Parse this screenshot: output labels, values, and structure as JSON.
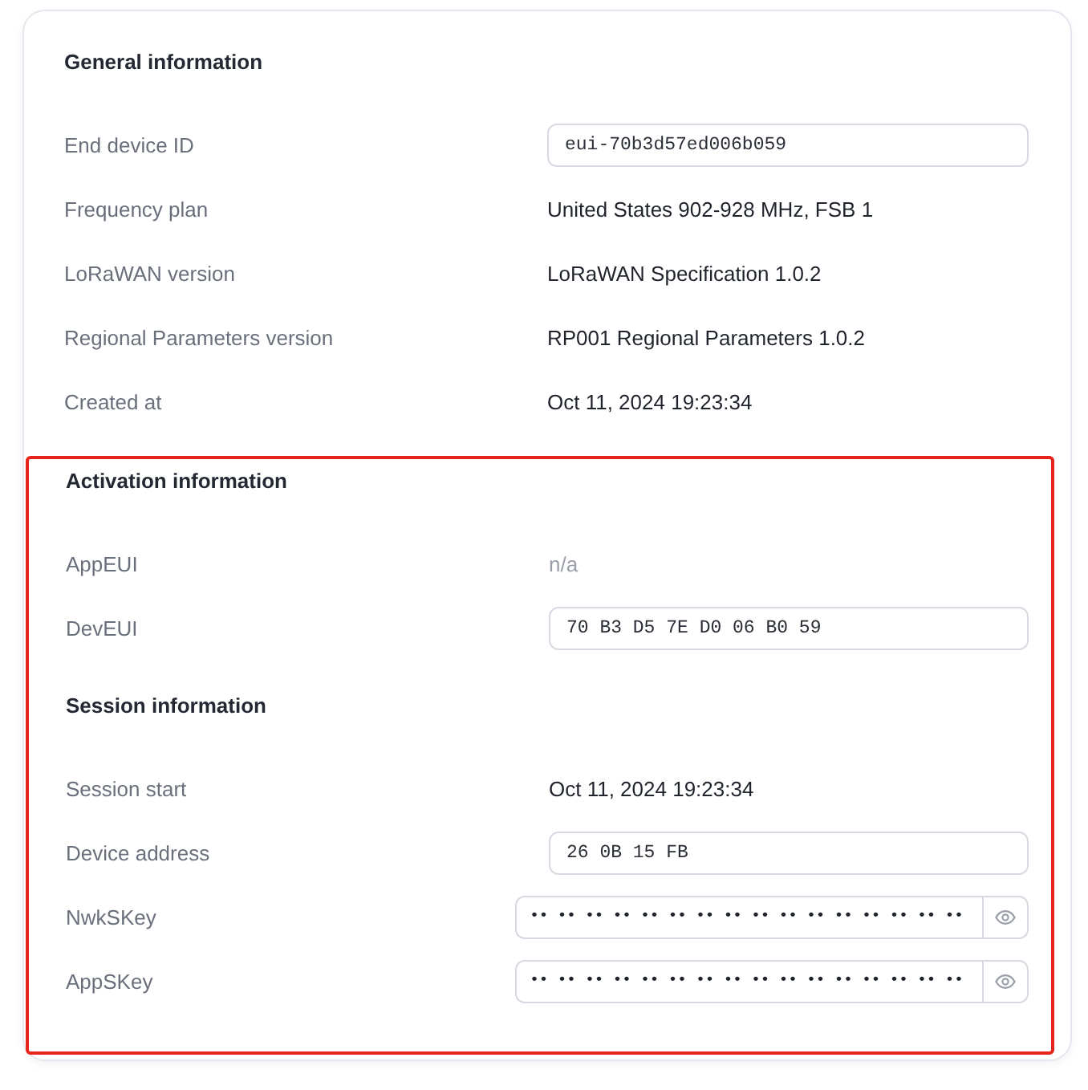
{
  "sections": [
    {
      "title": "General information",
      "highlighted": false,
      "rows": [
        {
          "label": "End device ID",
          "kind": "code",
          "value": "eui-70b3d57ed006b059"
        },
        {
          "label": "Frequency plan",
          "kind": "text",
          "value": "United States 902-928 MHz, FSB 1"
        },
        {
          "label": "LoRaWAN version",
          "kind": "text",
          "value": "LoRaWAN Specification 1.0.2"
        },
        {
          "label": "Regional Parameters version",
          "kind": "text",
          "value": "RP001 Regional Parameters 1.0.2"
        },
        {
          "label": "Created at",
          "kind": "text",
          "value": "Oct 11, 2024 19:23:34"
        }
      ]
    },
    {
      "title": "Activation information",
      "highlighted": true,
      "rows": [
        {
          "label": "AppEUI",
          "kind": "missing",
          "value": "n/a"
        },
        {
          "label": "DevEUI",
          "kind": "code",
          "value": "70 B3 D5 7E D0 06 B0 59"
        }
      ]
    },
    {
      "title": "Session information",
      "highlighted": true,
      "rows": [
        {
          "label": "Session start",
          "kind": "text",
          "value": "Oct 11, 2024 19:23:34"
        },
        {
          "label": "Device address",
          "kind": "code",
          "value": "26 0B 15 FB"
        },
        {
          "label": "NwkSKey",
          "kind": "secret",
          "value": "•• •• •• •• •• •• •• •• •• •• •• •• •• •• •• ••"
        },
        {
          "label": "AppSKey",
          "kind": "secret",
          "value": "•• •• •• •• •• •• •• •• •• •• •• •• •• •• •• ••"
        }
      ]
    }
  ]
}
